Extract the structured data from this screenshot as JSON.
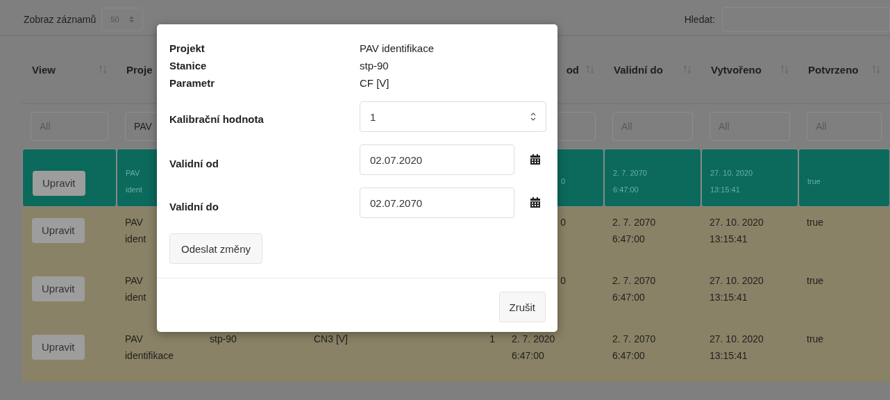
{
  "toolbar": {
    "length_label": "Zobraz záznamů",
    "length_value": "50",
    "search_label": "Hledat:"
  },
  "table": {
    "headers": {
      "view": {
        "label": "View",
        "sort_icon": true
      },
      "project": {
        "label": "Proje",
        "sort_icon": false
      },
      "valid_from": {
        "label": "od",
        "sort_icon": true
      },
      "valid_to": {
        "label": "Validní do",
        "sort_icon": true
      },
      "created": {
        "label": "Vytvořeno",
        "sort_icon": true
      },
      "confirmed": {
        "label": "Potvrzeno",
        "sort_icon": true
      }
    },
    "filters": {
      "view": {
        "placeholder": "All"
      },
      "project": {
        "value": "PAV"
      },
      "valid_to": {
        "placeholder": "All"
      },
      "created": {
        "placeholder": "All"
      },
      "confirmed": {
        "placeholder": "All"
      }
    },
    "rows": [
      {
        "selected": true,
        "button": "Upravit",
        "project": "PAV\nident",
        "valid_from": "0",
        "valid_to": "2. 7. 2070\n6:47:00",
        "created": "27. 10. 2020\n13:15:41",
        "confirmed": "true"
      },
      {
        "selected": false,
        "button": "Upravit",
        "project": "PAV\nident",
        "valid_from": "0",
        "valid_to": "2. 7. 2070\n6:47:00",
        "created": "27. 10. 2020\n13:15:41",
        "confirmed": "true"
      },
      {
        "selected": false,
        "button": "Upravit",
        "project": "PAV\nident",
        "valid_from": "0",
        "valid_to": "2. 7. 2070\n6:47:00",
        "created": "27. 10. 2020\n13:15:41",
        "confirmed": "true"
      },
      {
        "selected": false,
        "button": "Upravit",
        "project": "PAV\nidentifikace",
        "station": "stp-90",
        "parameter": "CN3 [V]",
        "calibration": "1",
        "valid_from": "2. 7. 2020\n6:47:00",
        "valid_to": "2. 7. 2070\n6:47:00",
        "created": "27. 10. 2020\n13:15:41",
        "confirmed": "true"
      }
    ]
  },
  "modal": {
    "fields": [
      {
        "kind": "text",
        "label": "Projekt",
        "value": "PAV identifikace"
      },
      {
        "kind": "text",
        "label": "Stanice",
        "value": "stp-90"
      },
      {
        "kind": "text",
        "label": "Parametr",
        "value": "CF [V]"
      },
      {
        "kind": "number",
        "label": "Kalibrační hodnota",
        "value": "1"
      },
      {
        "kind": "date",
        "label": "Validní od",
        "value": "02.07.2020"
      },
      {
        "kind": "date",
        "label": "Validní do",
        "value": "02.07.2070"
      }
    ],
    "submit": "Odeslat změny",
    "cancel": "Zrušit"
  }
}
